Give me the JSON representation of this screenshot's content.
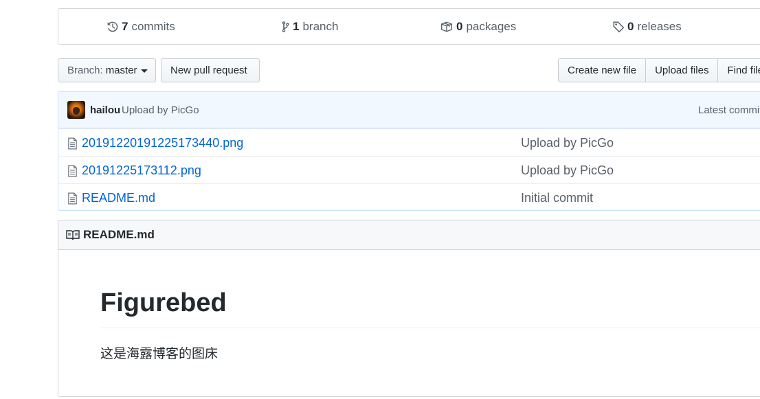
{
  "summary": {
    "commits": {
      "count": "7",
      "label": "commits",
      "icon": "history-icon"
    },
    "branch": {
      "count": "1",
      "label": "branch",
      "icon": "git-branch-icon"
    },
    "packages": {
      "count": "0",
      "label": "packages",
      "icon": "package-icon"
    },
    "releases": {
      "count": "0",
      "label": "releases",
      "icon": "tag-icon"
    }
  },
  "toolbar": {
    "branch_prefix": "Branch:",
    "branch_value": "master",
    "new_pull_request": "New pull request",
    "create_new_file": "Create new file",
    "upload_files": "Upload files",
    "find_file": "Find file"
  },
  "commit": {
    "author": "hailou",
    "message": "Upload by PicGo",
    "latest": "Latest commit"
  },
  "files": [
    {
      "name": "20191220191225173440.png",
      "message": "Upload by PicGo",
      "icon": "file-icon"
    },
    {
      "name": "20191225173112.png",
      "message": "Upload by PicGo",
      "icon": "file-icon"
    },
    {
      "name": "README.md",
      "message": "Initial commit",
      "icon": "file-icon"
    }
  ],
  "readme": {
    "header": "README.md",
    "icon": "book-icon",
    "title": "Figurebed",
    "text": "这是海露博客的图床"
  },
  "colors": {
    "link": "#0366d6",
    "commit_bar_bg": "#f1f8ff",
    "border_blue": "#c8e1ff",
    "muted_text": "#586069"
  }
}
